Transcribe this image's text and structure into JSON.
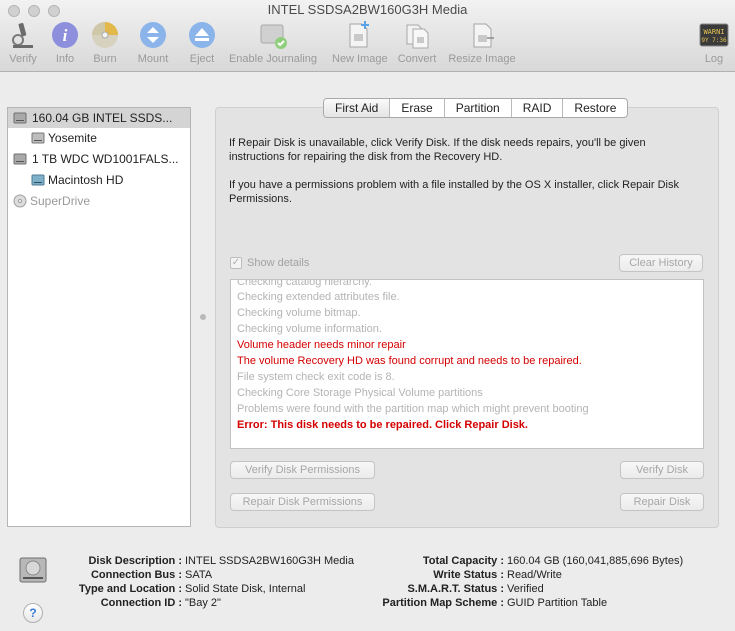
{
  "window": {
    "title": "INTEL SSDSA2BW160G3H Media"
  },
  "toolbar": {
    "verify": "Verify",
    "info": "Info",
    "burn": "Burn",
    "mount": "Mount",
    "eject": "Eject",
    "journaling": "Enable Journaling",
    "new_image": "New Image",
    "convert": "Convert",
    "resize": "Resize Image",
    "log": "Log",
    "log_badge": "WARNI\n9Y 7:36"
  },
  "sidebar": {
    "items": [
      {
        "label": "160.04 GB INTEL SSDS..."
      },
      {
        "label": "Yosemite"
      },
      {
        "label": "1 TB WDC WD1001FALS..."
      },
      {
        "label": "Macintosh HD"
      },
      {
        "label": "SuperDrive"
      }
    ]
  },
  "tabs": [
    "First Aid",
    "Erase",
    "Partition",
    "RAID",
    "Restore"
  ],
  "first_aid": {
    "para1": "If Repair Disk is unavailable, click Verify Disk. If the disk needs repairs, you'll be given instructions for repairing the disk from the Recovery HD.",
    "para2": "If you have a permissions problem with a file installed by the OS X installer, click Repair Disk Permissions.",
    "show_details": "Show details",
    "clear_history": "Clear History",
    "log": [
      "Checking catalog hierarchy.",
      "Checking extended attributes file.",
      "Checking volume bitmap.",
      "Checking volume information.",
      "Volume header needs minor repair",
      "The volume Recovery HD was found corrupt and needs to be repaired.",
      "File system check exit code is 8.",
      "Checking Core Storage Physical Volume partitions",
      "Problems were found with the partition map which might prevent booting",
      "Error: This disk needs to be repaired. Click Repair Disk."
    ],
    "verify_permissions": "Verify Disk Permissions",
    "verify_disk": "Verify Disk",
    "repair_permissions": "Repair Disk Permissions",
    "repair_disk": "Repair Disk"
  },
  "info": {
    "left": [
      {
        "key": "Disk Description :",
        "value": "INTEL SSDSA2BW160G3H Media"
      },
      {
        "key": "Connection Bus :",
        "value": "SATA"
      },
      {
        "key": "Type and Location :",
        "value": "Solid State Disk, Internal"
      },
      {
        "key": "Connection ID :",
        "value": "\"Bay 2\""
      }
    ],
    "right": [
      {
        "key": "Total Capacity :",
        "value": "160.04 GB (160,041,885,696 Bytes)"
      },
      {
        "key": "Write Status :",
        "value": "Read/Write"
      },
      {
        "key": "S.M.A.R.T. Status :",
        "value": "Verified"
      },
      {
        "key": "Partition Map Scheme :",
        "value": "GUID Partition Table"
      }
    ],
    "help": "?"
  },
  "colors": {
    "error": "#d40000",
    "disabled_text": "#b4b4b4",
    "selection": "#d4d4d4"
  }
}
